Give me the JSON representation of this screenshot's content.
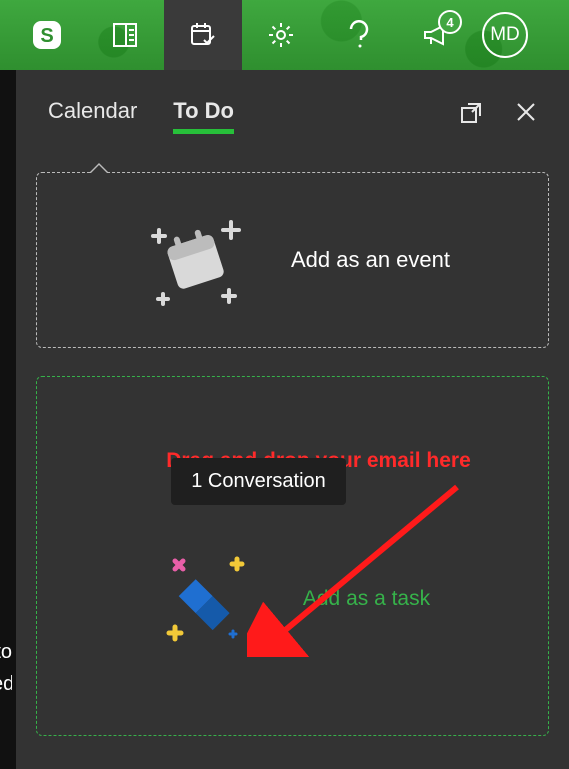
{
  "topbar": {
    "skype_icon": "S",
    "badge_count": "4",
    "avatar_initials": "MD"
  },
  "tabs": {
    "calendar": "Calendar",
    "todo": "To Do"
  },
  "event_drop": {
    "label": "Add as an event"
  },
  "task_drop": {
    "chip": "1 Conversation",
    "label": "Add as a task"
  },
  "annotation": {
    "text": "Drag and drop your email here"
  },
  "partial": {
    "line1": "to",
    "line2": "ed"
  }
}
